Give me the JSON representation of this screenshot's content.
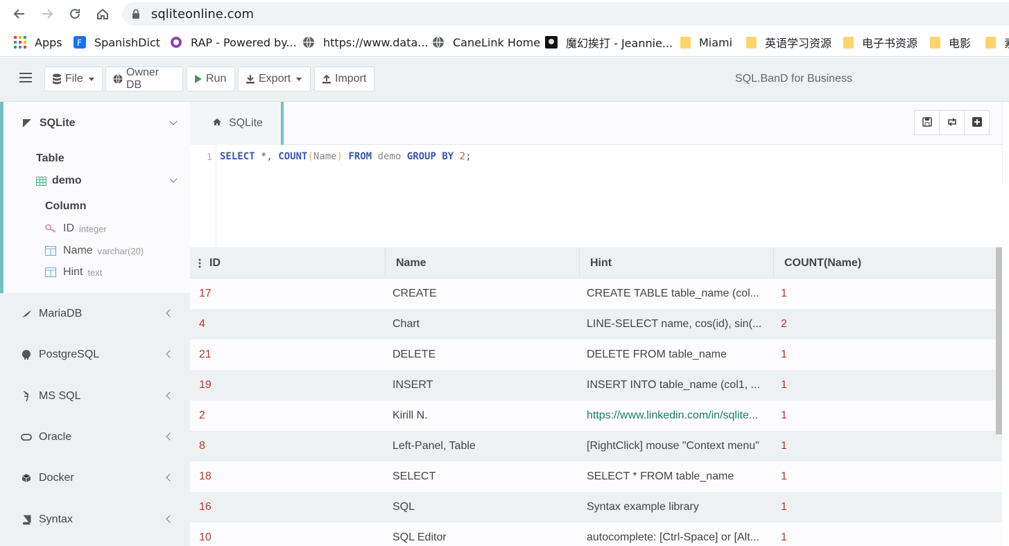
{
  "browser": {
    "url": "sqliteonline.com",
    "bookmarks": [
      {
        "label": "Apps",
        "icon": "apps-grid-icon"
      },
      {
        "label": "SpanishDict",
        "icon": "spanishdict-icon"
      },
      {
        "label": "RAP - Powered by...",
        "icon": "rap-icon"
      },
      {
        "label": "https://www.data...",
        "icon": "globe-icon"
      },
      {
        "label": "CaneLink Home",
        "icon": "globe-icon"
      },
      {
        "label": "魔幻挨打 - Jeannie...",
        "icon": "site-icon"
      },
      {
        "label": "Miami",
        "icon": "folder-icon"
      },
      {
        "label": "英语学习资源",
        "icon": "folder-icon"
      },
      {
        "label": "电子书资源",
        "icon": "folder-icon"
      },
      {
        "label": "电影",
        "icon": "folder-icon"
      },
      {
        "label": "素",
        "icon": "folder-icon"
      }
    ]
  },
  "toolbar": {
    "file": "File",
    "owner_db": "Owner DB",
    "run": "Run",
    "export": "Export",
    "import": "Import",
    "brand": "SQL.BanD for Business"
  },
  "sidebar": {
    "active_db": "SQLite",
    "table_heading": "Table",
    "table_name": "demo",
    "column_heading": "Column",
    "columns": [
      {
        "name": "ID",
        "type": "integer"
      },
      {
        "name": "Name",
        "type": "varchar(20)"
      },
      {
        "name": "Hint",
        "type": "text"
      }
    ],
    "databases": [
      "MariaDB",
      "PostgreSQL",
      "MS SQL",
      "Oracle",
      "Docker",
      "Syntax"
    ]
  },
  "editor": {
    "tab_label": "SQLite",
    "line_number": "1",
    "code_tokens": {
      "select": "SELECT",
      "star": " *, ",
      "count": "COUNT",
      "lp": "(",
      "name": "Name",
      "rp": ")",
      "from": " FROM ",
      "table": "demo",
      "group_by": " GROUP BY ",
      "two": "2",
      "semi": ";"
    }
  },
  "results": {
    "columns": [
      "ID",
      "Name",
      "Hint",
      "COUNT(Name)"
    ],
    "rows": [
      {
        "id": "17",
        "name": "CREATE",
        "hint": "CREATE TABLE table_name (col...",
        "count": "1"
      },
      {
        "id": "4",
        "name": "Chart",
        "hint": "LINE-SELECT name, cos(id), sin(...",
        "count": "2"
      },
      {
        "id": "21",
        "name": "DELETE",
        "hint": "DELETE FROM table_name",
        "count": "1"
      },
      {
        "id": "19",
        "name": "INSERT",
        "hint": "INSERT INTO table_name (col1, ...",
        "count": "1"
      },
      {
        "id": "2",
        "name": "Kirill N.",
        "hint": "https://www.linkedin.com/in/sqlite...",
        "count": "1"
      },
      {
        "id": "8",
        "name": "Left-Panel, Table",
        "hint": "[RightClick] mouse \"Context menu\"",
        "count": "1"
      },
      {
        "id": "18",
        "name": "SELECT",
        "hint": "SELECT * FROM table_name",
        "count": "1"
      },
      {
        "id": "16",
        "name": "SQL",
        "hint": "Syntax example library",
        "count": "1"
      },
      {
        "id": "10",
        "name": "SQL Editor",
        "hint": "autocomplete: [Ctrl-Space] or [Alt...",
        "count": "1"
      }
    ]
  },
  "colors": {
    "accent": "#76c1c0",
    "keyword": "#3957a8",
    "id_red": "#b33b2e",
    "link_green": "#1a7a6e"
  }
}
